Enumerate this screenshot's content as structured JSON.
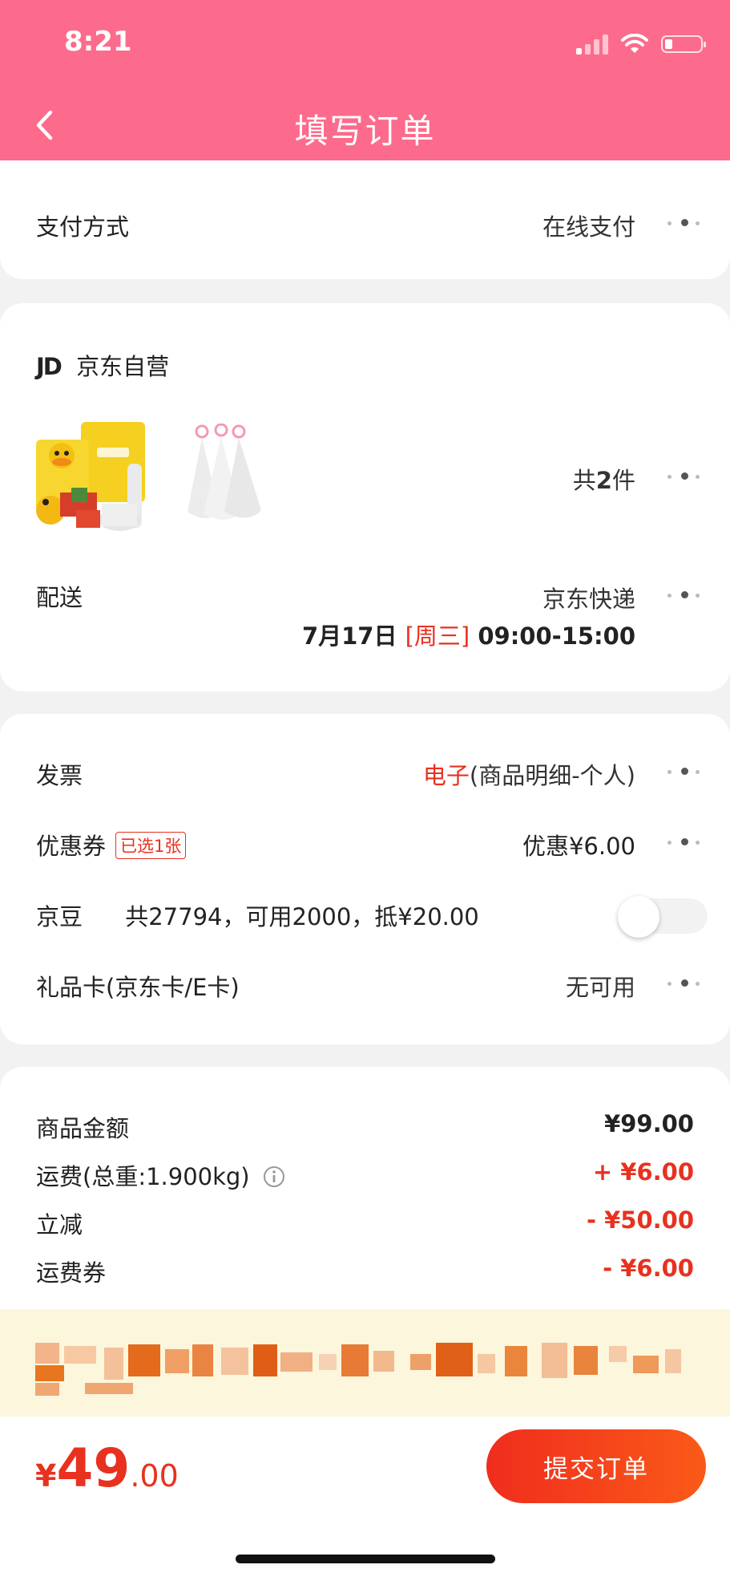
{
  "status_bar": {
    "time": "8:21"
  },
  "nav": {
    "title": "填写订单"
  },
  "payment": {
    "label": "支付方式",
    "value": "在线支付"
  },
  "store": {
    "logo_text": "JD",
    "name": "京东自营"
  },
  "items": {
    "count_prefix": "共",
    "count": "2",
    "count_suffix": "件"
  },
  "delivery": {
    "label": "配送",
    "method": "京东快递",
    "date": "7月17日",
    "weekday": "[周三]",
    "time_slot": "09:00-15:00"
  },
  "invoice": {
    "label": "发票",
    "type": "电子",
    "detail": "(商品明细-个人)"
  },
  "coupon": {
    "label": "优惠券",
    "badge": "已选1张",
    "value": "优惠¥6.00"
  },
  "jingdou": {
    "label": "京豆",
    "info": "共27794，可用2000，抵¥20.00",
    "enabled": false
  },
  "gift_card": {
    "label": "礼品卡(京东卡/E卡)",
    "value": "无可用"
  },
  "summary": {
    "goods_label": "商品金额",
    "goods_value": "¥99.00",
    "shipping_label": "运费(总重:1.900kg)",
    "shipping_value": "+ ¥6.00",
    "discount_label": "立减",
    "discount_value": "- ¥50.00",
    "ship_coupon_label": "运费券",
    "ship_coupon_value": "- ¥6.00"
  },
  "footer": {
    "currency": "¥",
    "total_int": "49",
    "total_dec": ".00",
    "submit_label": "提交订单"
  },
  "colors": {
    "header": "#fd6b8c",
    "accent": "#e8311f",
    "banner": "#fcf6dc"
  }
}
